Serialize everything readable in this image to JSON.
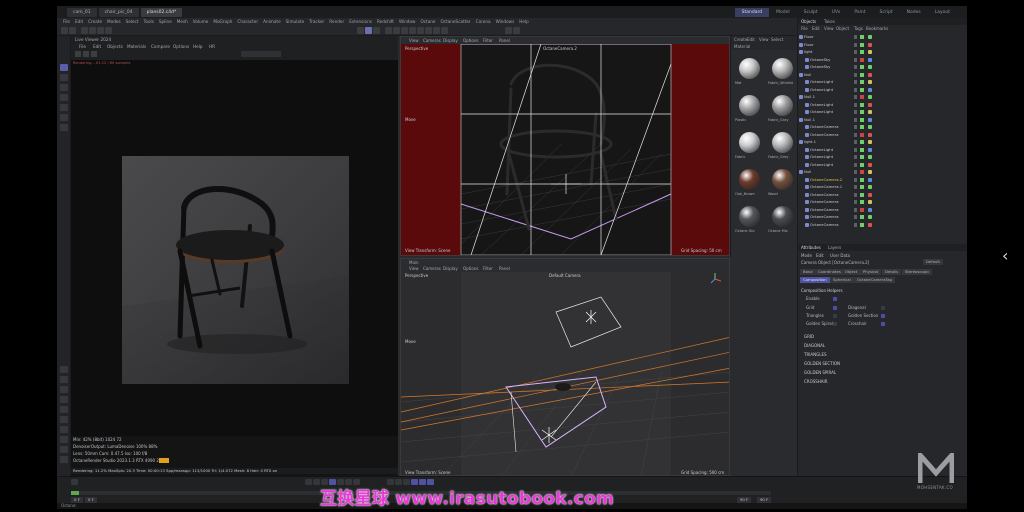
{
  "app": {
    "doc_tabs": [
      "cam_01",
      "chair_pic_04",
      "plans02.c4d*"
    ],
    "layout_tabs": [
      "Standard",
      "Model",
      "Sculpt",
      "UVs",
      "Paint",
      "Script",
      "Nodes",
      "Layout"
    ],
    "menu": [
      "File",
      "Edit",
      "Create",
      "Modes",
      "Select",
      "Tools",
      "Spline",
      "Mesh",
      "Volume",
      "MoGraph",
      "Character",
      "Animate",
      "Simulate",
      "Tracker",
      "Render",
      "Extensions",
      "Redshift",
      "Window",
      "Octane",
      "OctaneScatter",
      "Corona",
      "Windows",
      "Help"
    ],
    "colors": {
      "accent": "#5a5da8",
      "red_bg": "#5a0a0a",
      "cam_frame": "#d8b6ff",
      "orange_lines": "#d77a2a"
    }
  },
  "picture_viewer": {
    "title": "Live Viewer 2024",
    "menu": [
      "File",
      "Edit",
      "Objects",
      "Materials",
      "Compare",
      "Options",
      "Help",
      "HR"
    ],
    "stats_line": "Rendering... 01:12 / 60 samples",
    "info": [
      "Min: 42% (8bit)    1024    72",
      "DenoiserOutput: LumaDenoise  100%  88%",
      "Lens: 50mm  Cam: 0.47.5  Iso: 100 f/8",
      "OctaneRender Studio  2023.1.3  RTX 4090 24GB"
    ],
    "render_bar": "Rendering: 11.2%   MaxSpls: 20.3   Time: 00:00:13   Spp/maxspp: 113/1000   Tri: 1/4.072   Mesh: 8   Hair: 0   RTX on"
  },
  "viewport_top": {
    "menu": [
      "View",
      "Cameras",
      "Display",
      "Options",
      "Filter",
      "Panel"
    ],
    "mode": "Perspective",
    "camera": "OctaneCamera.2",
    "move_label": "Move",
    "footer_left": "View Transform: Scene",
    "footer_right": "Grid Spacing: 50 cm"
  },
  "viewport_bottom": {
    "title": "Main",
    "menu": [
      "View",
      "Cameras",
      "Display",
      "Options",
      "Filter",
      "Panel"
    ],
    "mode": "Perspective",
    "camera": "Default Camera",
    "move_label": "Move",
    "footer_left": "View Transform: Scene",
    "footer_right": "Grid Spacing: 500 cm"
  },
  "materials": {
    "menu": [
      "Create",
      "Edit",
      "View",
      "Select",
      "Material"
    ],
    "items": [
      {
        "name": "Mat",
        "color": "#c8c8c8"
      },
      {
        "name": "Fabric_Wrinkle",
        "color": "#b9b9bb"
      },
      {
        "name": "Plastic",
        "color": "#a8a8aa"
      },
      {
        "name": "Fabric_Gray",
        "color": "#9d9da0"
      },
      {
        "name": "Fabric",
        "color": "#cfcfd1"
      },
      {
        "name": "Fabric_Grey",
        "color": "#bcbcbf"
      },
      {
        "name": "Oak_Brown",
        "color": "#6a3b2a"
      },
      {
        "name": "Wood",
        "color": "#75503f"
      },
      {
        "name": "Octane Glo",
        "color": "#55565a"
      },
      {
        "name": "Octane Mix",
        "color": "#4a4b4f"
      }
    ]
  },
  "objects": {
    "tabs": [
      "Objects",
      "Takes"
    ],
    "menu": [
      "File",
      "Edit",
      "View",
      "Object",
      "Tags",
      "Bookmarks"
    ],
    "items": [
      "Floor",
      "Floor",
      "light",
      "OctaneSky",
      "OctaneSky",
      "Null",
      "OctaneLight",
      "OctaneLight",
      "Null.1",
      "OctaneLight",
      "OctaneLight",
      "Null.1",
      "OctaneCamera",
      "OctaneCamera",
      "light.1",
      "OctaneLight",
      "OctaneLight",
      "OctaneLight",
      "Null",
      "OctaneCamera.2",
      "OctaneCamera.1",
      "OctaneCamera",
      "OctaneCamera",
      "OctaneCamera",
      "OctaneCamera",
      "OctaneCamera"
    ]
  },
  "attributes": {
    "tabs": [
      "Attributes",
      "Layers"
    ],
    "menu": [
      "Mode",
      "Edit",
      "User Data"
    ],
    "object_label": "Camera Object [OctaneCamera.2]",
    "preset": "Default",
    "group_tabs": [
      "Basic",
      "Coordinates",
      "Object",
      "Physical",
      "Details",
      "Stereoscopic"
    ],
    "sub_tabs": [
      "Composition",
      "Spherical",
      "OctaneCameraTag"
    ],
    "section_title": "Composition Helpers",
    "options": [
      {
        "label": "Enable",
        "on": true
      },
      {
        "label": "Grid",
        "on": true
      },
      {
        "label": "Diagonal",
        "on": false
      },
      {
        "label": "Triangles",
        "on": false
      },
      {
        "label": "Golden Section",
        "on": true
      },
      {
        "label": "Golden Spiral",
        "on": false
      },
      {
        "label": "Crosshair",
        "on": true
      }
    ],
    "sections": [
      "GRID",
      "DIAGONAL",
      "TRIANGLES",
      "GOLDEN SECTION",
      "GOLDEN SPIRAL",
      "CROSSHAIR"
    ]
  },
  "timeline": {
    "start_frame": "0 F",
    "current_frame": "0 F",
    "end_frame": "90 F",
    "max_frame": "90 F"
  },
  "status": "Octane:",
  "watermark": "互换星球 www.irasutobook.com",
  "brand_logo_text": "MOHSENTAK.CO"
}
